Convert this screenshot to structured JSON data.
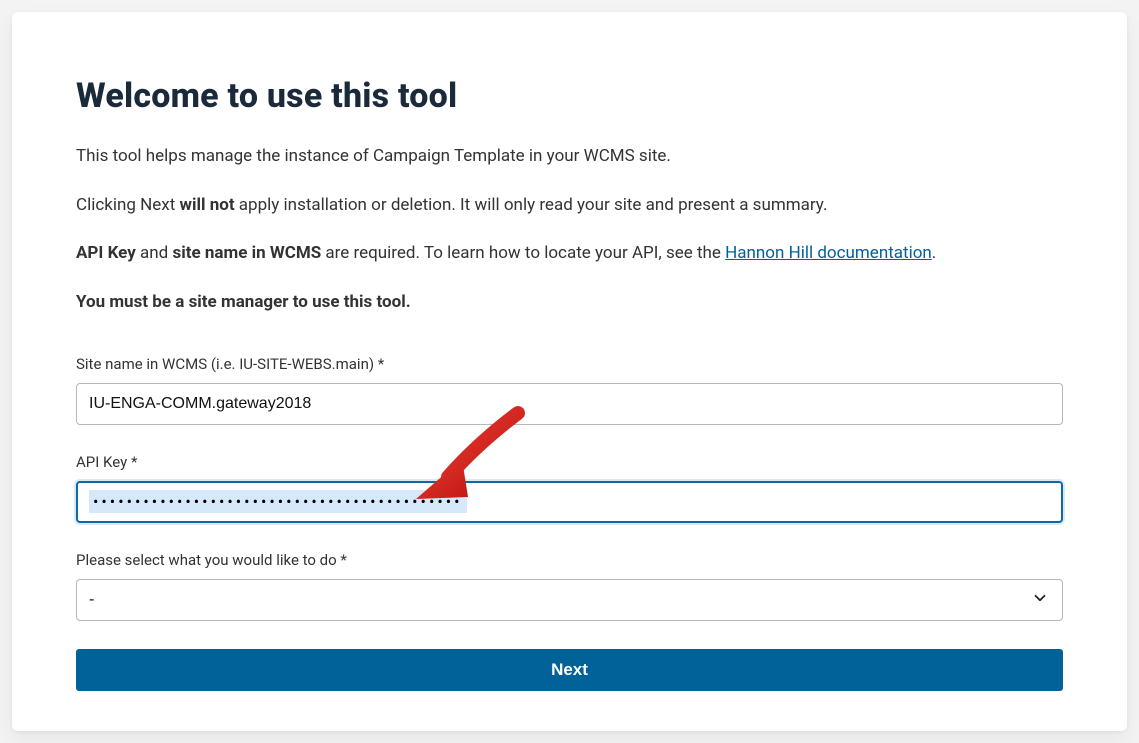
{
  "title": "Welcome to use this tool",
  "paragraphs": {
    "intro": "This tool helps manage the instance of Campaign Template in your WCMS site.",
    "clicking_pre": "Clicking Next ",
    "clicking_bold": "will not",
    "clicking_post": " apply installation or deletion. It will only read your site and present a summary.",
    "req_bold1": "API Key",
    "req_mid": " and ",
    "req_bold2": "site name in WCMS",
    "req_post": " are required. To learn how to locate your API, see the ",
    "docs_link_text": "Hannon Hill documentation",
    "req_end": ".",
    "must_be": "You must be a site manager to use this tool."
  },
  "fields": {
    "site_name": {
      "label": "Site name in WCMS (i.e. IU-SITE-WEBS.main) *",
      "value": "IU-ENGA-COMM.gateway2018"
    },
    "api_key": {
      "label": "API Key *",
      "masked": "••••••••••••••••••••••••••••••••••••••••••••"
    },
    "action": {
      "label": "Please select what you would like to do *",
      "selected": "-"
    }
  },
  "buttons": {
    "next": "Next"
  },
  "colors": {
    "accent": "#006298"
  }
}
